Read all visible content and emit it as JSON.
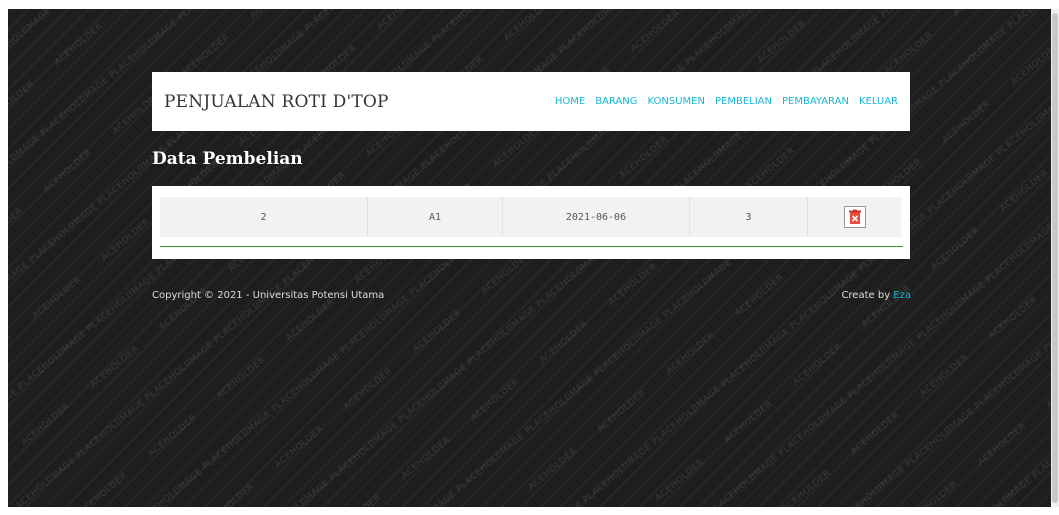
{
  "site": {
    "title": "PENJUALAN ROTI D'TOP",
    "nav": [
      "HOME",
      "BARANG",
      "KONSUMEN",
      "PEMBELIAN",
      "PEMBAYARAN",
      "KELUAR"
    ]
  },
  "page": {
    "heading": "Data Pembelian"
  },
  "table": {
    "rows": [
      [
        "2",
        "A1",
        "2021-06-06",
        "3"
      ]
    ],
    "delete_icon": "delete-icon"
  },
  "footer": {
    "copyright": "Copyright © 2021 - Universitas Potensi Utama",
    "create_by": "Create by",
    "author": "Eza"
  },
  "colors": {
    "accent": "#19b6d1",
    "divider": "#3a8a2e",
    "delete": "#e74c3c"
  }
}
